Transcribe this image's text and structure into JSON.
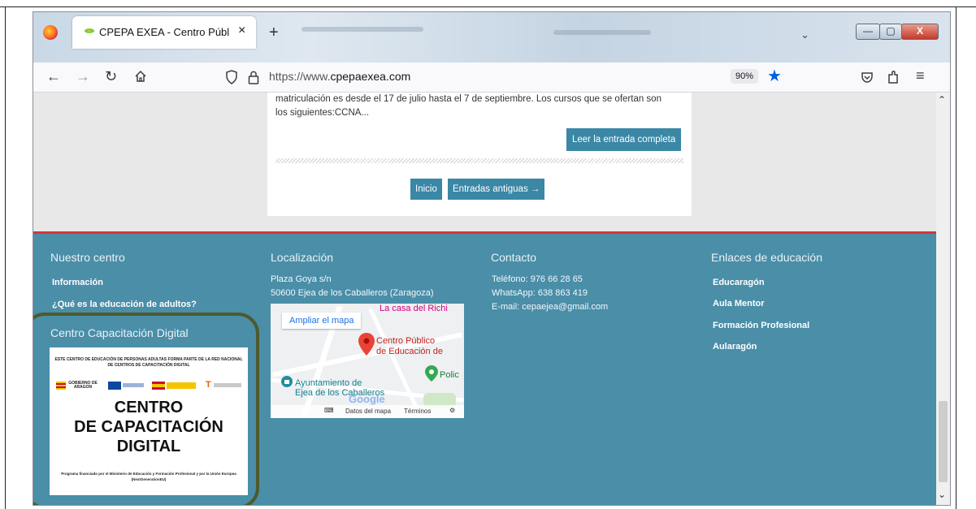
{
  "browser": {
    "tab_title": "CPEPA EXEA - Centro Público de",
    "tab_close": "×",
    "new_tab": "+",
    "tab_list": "⌄",
    "url_prefix": "https://www.",
    "url_domain": "cpepaexea.com",
    "zoom": "90%",
    "window_buttons": {
      "minimize": "—",
      "maximize": "▢",
      "close": "X"
    }
  },
  "post": {
    "excerpt_line1": "matriculación es desde el 17 de julio hasta el 7 de septiembre. Los cursos que se ofertan son",
    "excerpt_line2": "los siguientes:CCNA...",
    "read_more": "Leer la entrada completa"
  },
  "pagination": {
    "home": "Inicio",
    "older": "Entradas antiguas →"
  },
  "footer": {
    "col1": {
      "title": "Nuestro centro",
      "links": [
        "Información",
        "¿Qué es la educación de adultos?"
      ],
      "subtitle": "Centro Capacitación Digital"
    },
    "col2": {
      "title": "Localización",
      "address1": "Plaza Goya s/n",
      "address2": "50600 Ejea de los Caballeros (Zaragoza)"
    },
    "col3": {
      "title": "Contacto",
      "phone": "Teléfono: 976 66 28 65",
      "whatsapp": "WhatsApp: 638 863 419",
      "email": "E-mail: cepaejea@gmail.com"
    },
    "col4": {
      "title": "Enlaces de educación",
      "links": [
        "Educaragón",
        "Aula Mentor",
        "Formación Profesional",
        "Aularagón"
      ]
    }
  },
  "map": {
    "enlarge": "Ampliar el mapa",
    "place_top": "La casa del Richi",
    "place_main_1": "Centro Público",
    "place_main_2": "de Educación de",
    "place_ayto_1": "Ayuntamiento de",
    "place_ayto_2": "Ejea de los Caballeros",
    "place_poli": "Polic",
    "google": "Google",
    "map_data": "Datos del mapa",
    "terms": "Términos"
  },
  "badge": {
    "top_text": "ESTE CENTRO DE EDUCACIÓN DE PERSONAS ADULTAS FORMA PARTE DE LA RED NACIONAL DE CENTROS DE CAPACITACIÓN DIGITAL",
    "line1": "CENTRO",
    "line2": "DE CAPACITACIÓN",
    "line3": "DIGITAL",
    "bottom_text": "Programa financiado por el Ministerio de Educación y Formación Profesional y por la Unión Europea (NextGenerationEU)",
    "logo1": "GOBIERNO DE ARAGON"
  },
  "colors": {
    "footer_bg": "#4a8ea8",
    "footer_border": "#d8353a",
    "button_bg": "#3a87a6",
    "highlight_box": "#4d5a2c"
  }
}
